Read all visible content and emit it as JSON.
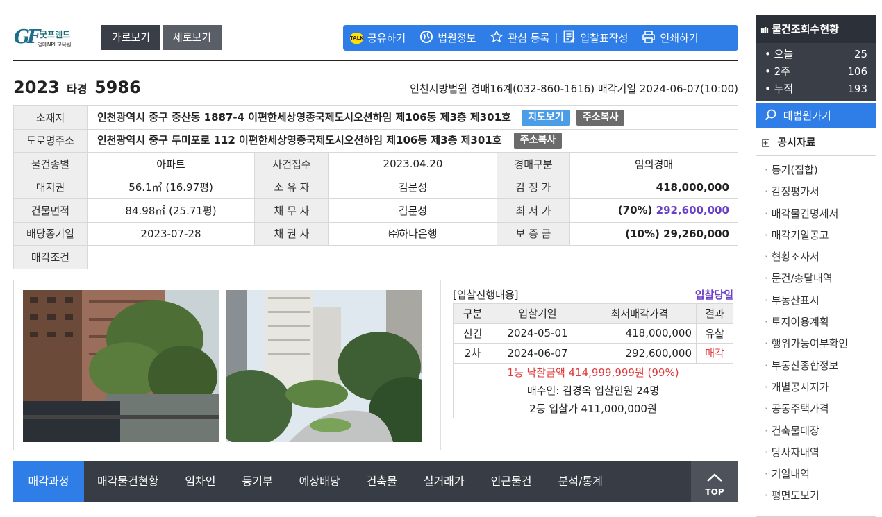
{
  "logo": {
    "gf": "GF",
    "name": "굿프렌드",
    "sub": "경매NPL교육원"
  },
  "view": {
    "horizontal": "가로보기",
    "vertical": "세로보기"
  },
  "toolbar": {
    "share": "공유하기",
    "court_info": "법원정보",
    "favorite": "관심 등록",
    "bid_form": "입찰표작성",
    "print": "인쇄하기",
    "kakao_mark": "TALK"
  },
  "case": {
    "year": "2023",
    "type": "타경",
    "number": "5986",
    "court_info": "인천지방법원 경매16계(032-860-1616) 매각기일 2024-06-07(10:00)"
  },
  "info": {
    "location_label": "소재지",
    "location": "인천광역시 중구 중산동 1887-4 이편한세상영종국제도시오션하임 제106동 제3층 제301호",
    "map_btn": "지도보기",
    "copy_btn": "주소복사",
    "road_label": "도로명주소",
    "road": "인천광역시 중구 두미포로 112 이편한세상영종국제도시오션하임 제106동 제3층 제301호",
    "rows": [
      [
        "물건종별",
        "아파트",
        "사건접수",
        "2023.04.20",
        "경매구분",
        "임의경매"
      ],
      [
        "대지권",
        "56.1㎡ (16.97평)",
        "소 유 자",
        "김문성",
        "감 정 가",
        "418,000,000"
      ],
      [
        "건물면적",
        "84.98㎡ (25.71평)",
        "채 무 자",
        "김문성",
        "최 저 가",
        ""
      ],
      [
        "배당종기일",
        "2023-07-28",
        "채 권 자",
        "㈜하나은행",
        "보 증 금",
        "(10%) 29,260,000"
      ]
    ],
    "min_price_pct": "(70%)",
    "min_price": "292,600,000",
    "sale_cond_label": "매각조건"
  },
  "bids": {
    "title": "[입찰진행내용]",
    "status": "입찰당일",
    "headers": [
      "구분",
      "입찰기일",
      "최저매각가격",
      "결과"
    ],
    "rows": [
      [
        "신건",
        "2024-05-01",
        "418,000,000",
        "유찰"
      ],
      [
        "2차",
        "2024-06-07",
        "292,600,000",
        "매각"
      ]
    ],
    "winner": "1등 낙찰금액 414,999,999원 (99%)",
    "buyer": "매수인: 김경옥 입찰인원 24명",
    "second": "2등 입찰가 411,000,000원"
  },
  "tabs": [
    "매각과정",
    "매각물건현황",
    "임차인",
    "등기부",
    "예상배당",
    "건축물",
    "실거래가",
    "인근물건",
    "분석/통계"
  ],
  "top_label": "TOP",
  "sidebar": {
    "title": "물건조회수현황",
    "stats": [
      [
        "오늘",
        "25"
      ],
      [
        "2주",
        "106"
      ],
      [
        "누적",
        "193"
      ]
    ],
    "court_link": "대법원가기",
    "public_docs": "공시자료",
    "items": [
      "등기(집합)",
      "감정평가서",
      "매각물건명세서",
      "매각기일공고",
      "현황조사서",
      "문건/송달내역",
      "부동산표시",
      "토지이용계획",
      "행위가능여부확인",
      "부동산종합정보",
      "개별공시지가",
      "공동주택가격",
      "건축물대장",
      "당사자내역",
      "기일내역",
      "평면도보기"
    ]
  },
  "colors": {
    "accent": "#2f7ee8",
    "dark": "#383c44",
    "purple": "#6a3fc8",
    "red": "#e03a3a"
  }
}
